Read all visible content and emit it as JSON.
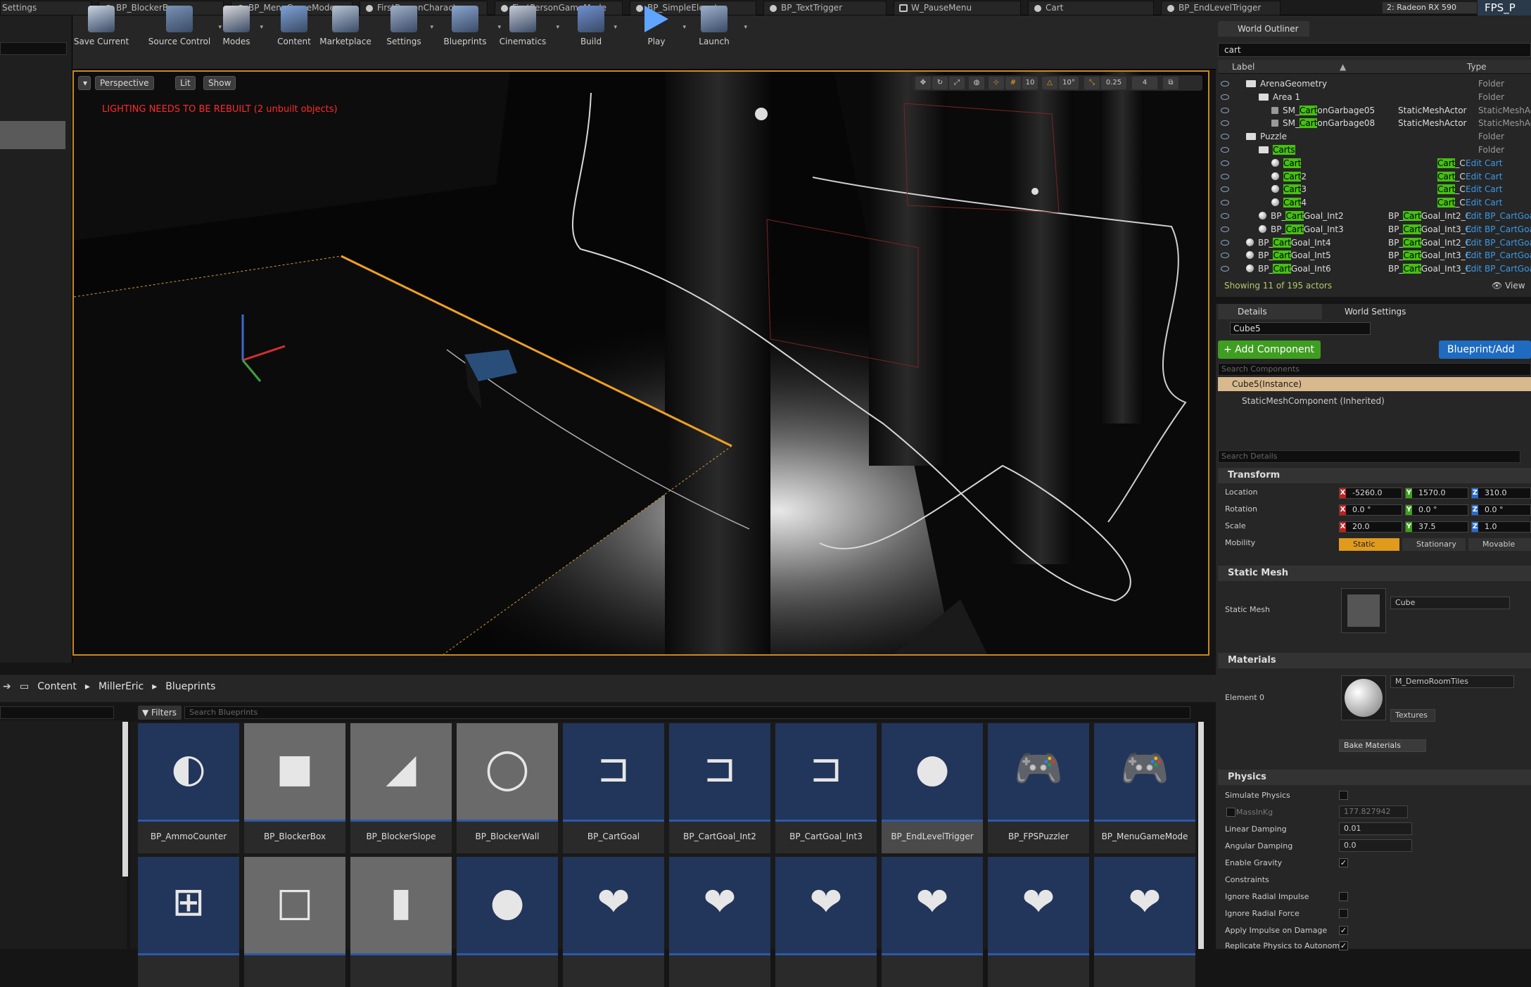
{
  "tabs": [
    {
      "label": "Settings",
      "icon": "none"
    },
    {
      "label": "BP_BlockerBox",
      "icon": "blueprint"
    },
    {
      "label": "BP_MenuGameMode",
      "icon": "blueprint"
    },
    {
      "label": "FirstPersonCharacter",
      "icon": "blueprint"
    },
    {
      "label": "FirstPersonGameMode",
      "icon": "blueprint"
    },
    {
      "label": "BP_SimpleElevator",
      "icon": "blueprint"
    },
    {
      "label": "BP_TextTrigger",
      "icon": "blueprint"
    },
    {
      "label": "W_PauseMenu",
      "icon": "widget"
    },
    {
      "label": "Cart",
      "icon": "blueprint"
    },
    {
      "label": "BP_EndLevelTrigger",
      "icon": "blueprint"
    }
  ],
  "gpu": "2: Radeon RX 590",
  "project": "FPS_P",
  "toolbar": [
    {
      "label": "Save Current",
      "icon": "save-icon",
      "color": "#c9d4e2"
    },
    {
      "label": "Source Control",
      "icon": "source-control-icon",
      "color": "#7a93b5"
    },
    {
      "label": "Modes",
      "icon": "modes-icon",
      "color": "#d8d8d8"
    },
    {
      "label": "Content",
      "icon": "content-icon",
      "color": "#7fa3d6"
    },
    {
      "label": "Marketplace",
      "icon": "marketplace-icon",
      "color": "#b7c4d6"
    },
    {
      "label": "Settings",
      "icon": "settings-icon",
      "color": "#9fb0c8"
    },
    {
      "label": "Blueprints",
      "icon": "blueprints-icon",
      "color": "#8aa6cf"
    },
    {
      "label": "Cinematics",
      "icon": "cinematics-icon",
      "color": "#c6ccd6"
    },
    {
      "label": "Build",
      "icon": "build-icon",
      "color": "#6f8fd0"
    },
    {
      "label": "Play",
      "icon": "play-icon",
      "color": "#5fa4ff"
    },
    {
      "label": "Launch",
      "icon": "launch-icon",
      "color": "#9cb0cc"
    }
  ],
  "viewport": {
    "perspective": "Perspective",
    "lit": "Lit",
    "show": "Show",
    "warning": "LIGHTING NEEDS TO BE REBUILT (2 unbuilt objects)",
    "grid_snap": "10",
    "rot_snap": "10°",
    "scale_snap": "0.25",
    "cam_speed": "4"
  },
  "outliner": {
    "title": "World Outliner",
    "search": "cart",
    "col_label": "Label",
    "col_type": "Type",
    "rows": [
      {
        "indent": 0,
        "kind": "folder",
        "pre": "ArenaGeometry",
        "hl": "",
        "post": "",
        "type": "Folder",
        "type_hl": "",
        "type_post": "",
        "edit": ""
      },
      {
        "indent": 1,
        "kind": "folder",
        "pre": "Area 1",
        "hl": "",
        "post": "",
        "type": "Folder",
        "type_hl": "",
        "type_post": "",
        "edit": ""
      },
      {
        "indent": 2,
        "kind": "mesh",
        "pre": "SM_",
        "hl": "Cart",
        "post": "onGarbage05",
        "type": "StaticMeshActor",
        "type_hl": "",
        "type_post": "",
        "edit": "StaticMeshActor"
      },
      {
        "indent": 2,
        "kind": "mesh",
        "pre": "SM_",
        "hl": "Cart",
        "post": "onGarbage08",
        "type": "StaticMeshActor",
        "type_hl": "",
        "type_post": "",
        "edit": "StaticMeshActor"
      },
      {
        "indent": 0,
        "kind": "folder",
        "pre": "Puzzle",
        "hl": "",
        "post": "",
        "type": "Folder",
        "type_hl": "",
        "type_post": "",
        "edit": ""
      },
      {
        "indent": 1,
        "kind": "folder",
        "pre": "",
        "hl": "Carts",
        "post": "",
        "type": "Folder",
        "type_hl": "",
        "type_post": "",
        "edit": ""
      },
      {
        "indent": 2,
        "kind": "ball",
        "pre": "",
        "hl": "Cart",
        "post": "",
        "type": "",
        "type_hl": "Cart",
        "type_post": "_C",
        "edit": "Edit Cart"
      },
      {
        "indent": 2,
        "kind": "ball",
        "pre": "",
        "hl": "Cart",
        "post": "2",
        "type": "",
        "type_hl": "Cart",
        "type_post": "_C",
        "edit": "Edit Cart"
      },
      {
        "indent": 2,
        "kind": "ball",
        "pre": "",
        "hl": "Cart",
        "post": "3",
        "type": "",
        "type_hl": "Cart",
        "type_post": "_C",
        "edit": "Edit Cart"
      },
      {
        "indent": 2,
        "kind": "ball",
        "pre": "",
        "hl": "Cart",
        "post": "4",
        "type": "",
        "type_hl": "Cart",
        "type_post": "_C",
        "edit": "Edit Cart"
      },
      {
        "indent": 1,
        "kind": "ball",
        "pre": "BP_",
        "hl": "Cart",
        "post": "Goal_Int2",
        "type": "BP_",
        "type_hl": "Cart",
        "type_post": "Goal_Int2_C",
        "edit": "Edit BP_CartGoa"
      },
      {
        "indent": 1,
        "kind": "ball",
        "pre": "BP_",
        "hl": "Cart",
        "post": "Goal_Int3",
        "type": "BP_",
        "type_hl": "Cart",
        "type_post": "Goal_Int3_C",
        "edit": "Edit BP_CartGoa"
      },
      {
        "indent": 0,
        "kind": "ball",
        "pre": "BP_",
        "hl": "Cart",
        "post": "Goal_Int4",
        "type": "BP_",
        "type_hl": "Cart",
        "type_post": "Goal_Int2_C",
        "edit": "Edit BP_CartGoa"
      },
      {
        "indent": 0,
        "kind": "ball",
        "pre": "BP_",
        "hl": "Cart",
        "post": "Goal_Int5",
        "type": "BP_",
        "type_hl": "Cart",
        "type_post": "Goal_Int3_C",
        "edit": "Edit BP_CartGoa"
      },
      {
        "indent": 0,
        "kind": "ball",
        "pre": "BP_",
        "hl": "Cart",
        "post": "Goal_Int6",
        "type": "BP_",
        "type_hl": "Cart",
        "type_post": "Goal_Int3_C",
        "edit": "Edit BP_CartGoa"
      }
    ],
    "showing": "Showing 11 of 195 actors",
    "view_options": "View"
  },
  "details": {
    "tab_details": "Details",
    "tab_world": "World Settings",
    "name": "Cube5",
    "add_component": "+ Add Component",
    "blueprint_add": "Blueprint/Add",
    "search_components": "Search Components",
    "instance": "Cube5(Instance)",
    "component": "StaticMeshComponent (Inherited)",
    "search_details": "Search Details",
    "transform": "Transform",
    "location": {
      "label": "Location",
      "x": "-5260.0",
      "y": "1570.0",
      "z": "310.0"
    },
    "rotation": {
      "label": "Rotation",
      "x": "0.0 °",
      "y": "0.0 °",
      "z": "0.0 °"
    },
    "scale": {
      "label": "Scale",
      "x": "20.0",
      "y": "37.5",
      "z": "1.0"
    },
    "mobility": {
      "label": "Mobility",
      "static": "Static",
      "stationary": "Stationary",
      "movable": "Movable"
    },
    "static_mesh_section": "Static Mesh",
    "static_mesh_label": "Static Mesh",
    "static_mesh_value": "Cube",
    "materials_section": "Materials",
    "element0": "Element 0",
    "material_value": "M_DemoRoomTiles",
    "textures": "Textures",
    "bake_materials": "Bake Materials",
    "physics_section": "Physics",
    "simulate_physics": "Simulate Physics",
    "mass": "MassInKg",
    "mass_value": "177.827942",
    "linear_damping": "Linear Damping",
    "linear_damping_value": "0.01",
    "angular_damping": "Angular Damping",
    "angular_damping_value": "0.0",
    "enable_gravity": "Enable Gravity",
    "constraints": "Constraints",
    "ignore_radial_impulse": "Ignore Radial Impulse",
    "ignore_radial_force": "Ignore Radial Force",
    "apply_impulse": "Apply Impulse on Damage",
    "replicate": "Replicate Physics to Autonomo"
  },
  "content": {
    "breadcrumb": [
      "Content",
      "MillerEric",
      "Blueprints"
    ],
    "filters": "Filters",
    "search_placeholder": "Search Blueprints",
    "assets_row1": [
      {
        "name": "BP_AmmoCounter",
        "icon": "ammo-icon"
      },
      {
        "name": "BP_BlockerBox",
        "icon": "box-icon"
      },
      {
        "name": "BP_BlockerSlope",
        "icon": "slope-icon"
      },
      {
        "name": "BP_BlockerWall",
        "icon": "wall-icon"
      },
      {
        "name": "BP_CartGoal",
        "icon": "goal-icon"
      },
      {
        "name": "BP_CartGoal_Int2",
        "icon": "goal-icon"
      },
      {
        "name": "BP_CartGoal_Int3",
        "icon": "goal-icon"
      },
      {
        "name": "BP_EndLevelTrigger",
        "icon": "sphere-icon"
      },
      {
        "name": "BP_FPSPuzzler",
        "icon": "gamepad-icon"
      },
      {
        "name": "BP_MenuGameMode",
        "icon": "gamepad-icon"
      }
    ],
    "assets_row2": [
      {
        "name": "",
        "icon": "hud-icon"
      },
      {
        "name": "",
        "icon": "cube-icon"
      },
      {
        "name": "",
        "icon": "cylinder-icon"
      },
      {
        "name": "",
        "icon": "sphere-icon"
      },
      {
        "name": "",
        "icon": "heart-icon"
      },
      {
        "name": "",
        "icon": "heart-icon"
      },
      {
        "name": "",
        "icon": "heart-icon"
      },
      {
        "name": "",
        "icon": "heart-icon"
      },
      {
        "name": "",
        "icon": "heart-icon"
      },
      {
        "name": "",
        "icon": "heart-icon"
      }
    ]
  }
}
